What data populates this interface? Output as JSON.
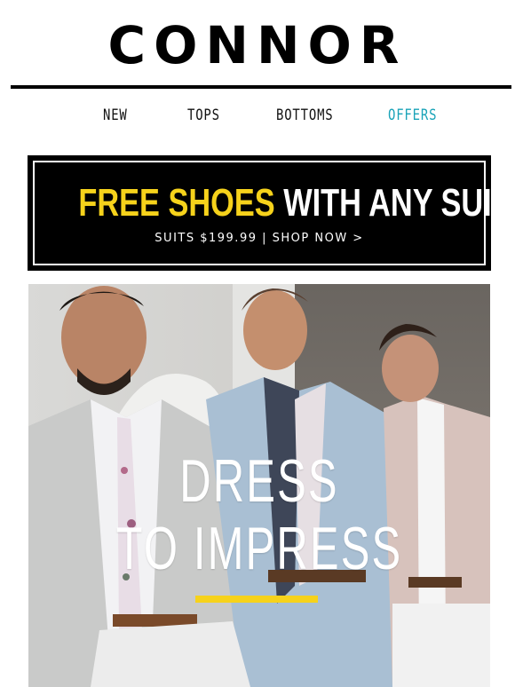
{
  "brand": {
    "logo_text": "CONNOR"
  },
  "nav": {
    "items": [
      {
        "label": "NEW"
      },
      {
        "label": "TOPS"
      },
      {
        "label": "BOTTOMS"
      },
      {
        "label": "OFFERS"
      }
    ],
    "accent_color": "#1aa3b8"
  },
  "promo": {
    "headline_highlight": "FREE SHOES",
    "headline_rest": "WITH ANY SUIT",
    "subline": "SUITS $199.99  |  SHOP NOW >",
    "highlight_color": "#f6d21b"
  },
  "hero": {
    "title_line1": "DRESS",
    "title_line2": "TO IMPRESS",
    "underline_color": "#f6d21b"
  }
}
